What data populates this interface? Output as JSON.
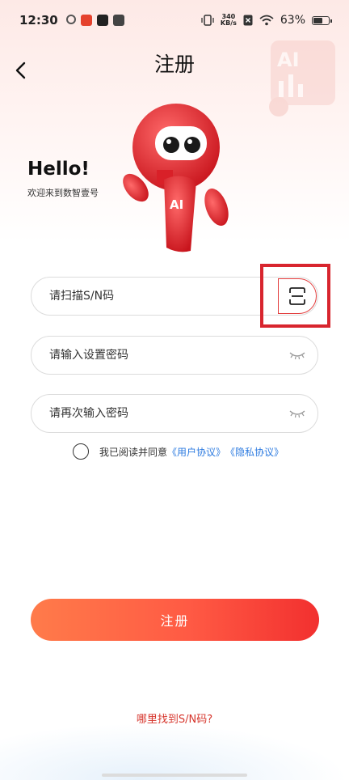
{
  "status_bar": {
    "time": "12:30",
    "net_speed_value": "340",
    "net_speed_unit": "KB/s",
    "battery_percent": "63%",
    "battery_level": 0.63
  },
  "header": {
    "title": "注册"
  },
  "greeting": {
    "title": "Hello!",
    "subtitle": "欢迎来到数智壹号"
  },
  "mascot": {
    "badge": "AI"
  },
  "form": {
    "sn_placeholder": "请扫描S/N码",
    "password_placeholder": "请输入设置密码",
    "confirm_placeholder": "请再次输入密码"
  },
  "agreement": {
    "prefix": "我已阅读并同意",
    "user_agreement": "《用户协议》",
    "privacy_agreement": "《隐私协议》",
    "checked": false
  },
  "submit_label": "注册",
  "help_link": "哪里找到S/N码?",
  "colors": {
    "accent": "#f2302f",
    "link": "#2d7be0",
    "highlight": "#d8252e"
  },
  "icons": [
    "back-arrow-icon",
    "scan-icon",
    "eye-closed-icon",
    "checkbox-circle-icon"
  ]
}
